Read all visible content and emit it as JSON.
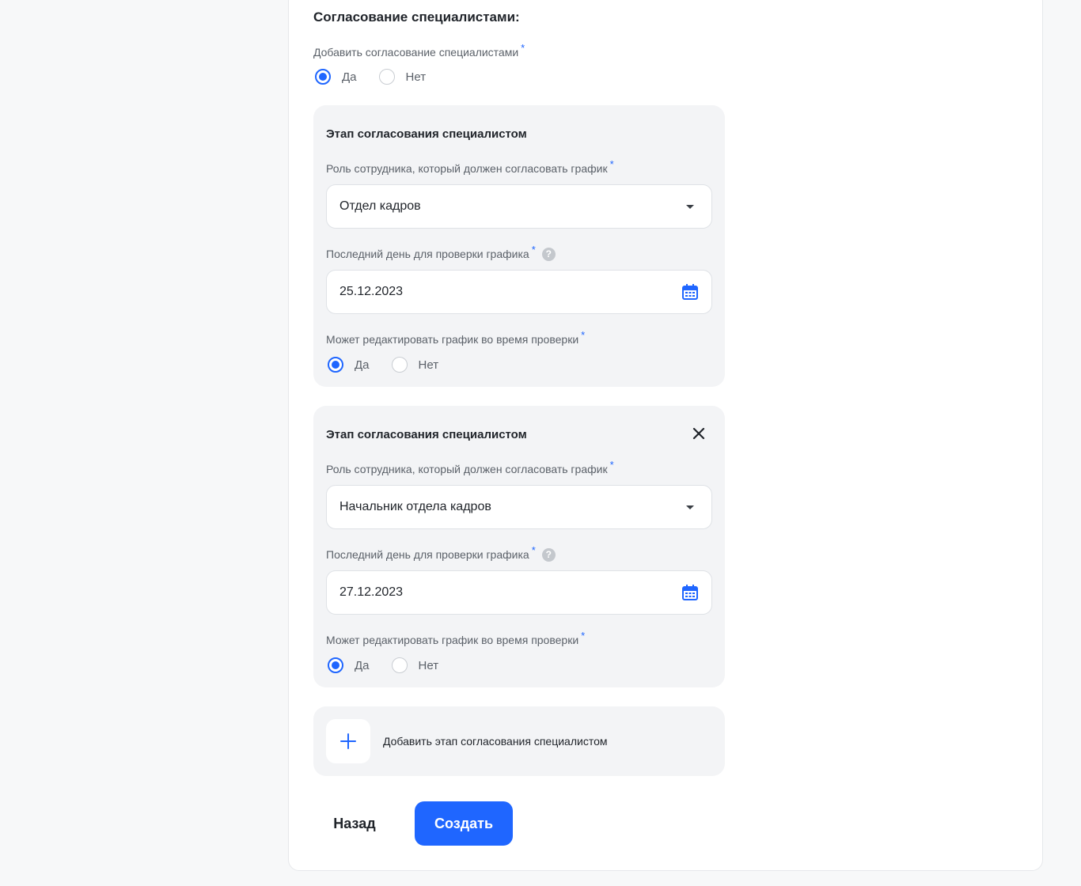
{
  "section": {
    "title": "Согласование специалистами:",
    "add_label": "Добавить согласование специалистами",
    "required_mark": "*",
    "yes": "Да",
    "no": "Нет",
    "selected": "yes"
  },
  "stages": [
    {
      "title": "Этап согласования специалистом",
      "role_label": "Роль сотрудника, который должен согласовать график",
      "role_value": "Отдел кадров",
      "date_label": "Последний день для проверки графика",
      "date_value": "25.12.2023",
      "edit_label": "Может редактировать график во время проверки",
      "yes": "Да",
      "no": "Нет",
      "selected": "yes",
      "removable": false
    },
    {
      "title": "Этап согласования специалистом",
      "role_label": "Роль сотрудника, который должен согласовать график",
      "role_value": "Начальник отдела кадров",
      "date_label": "Последний день для проверки графика",
      "date_value": "27.12.2023",
      "edit_label": "Может редактировать график во время проверки",
      "yes": "Да",
      "no": "Нет",
      "selected": "yes",
      "removable": true
    }
  ],
  "add_stage": {
    "label": "Добавить этап согласования специалистом"
  },
  "actions": {
    "back": "Назад",
    "create": "Создать"
  },
  "help_glyph": "?",
  "colors": {
    "accent": "#1f66ff",
    "card_bg": "#f3f4f6",
    "page_bg": "#f7f8f9"
  },
  "icons": {
    "select": "chevron-down-icon",
    "date": "calendar-icon",
    "remove": "close-icon",
    "add": "plus-icon",
    "help": "help-icon"
  }
}
